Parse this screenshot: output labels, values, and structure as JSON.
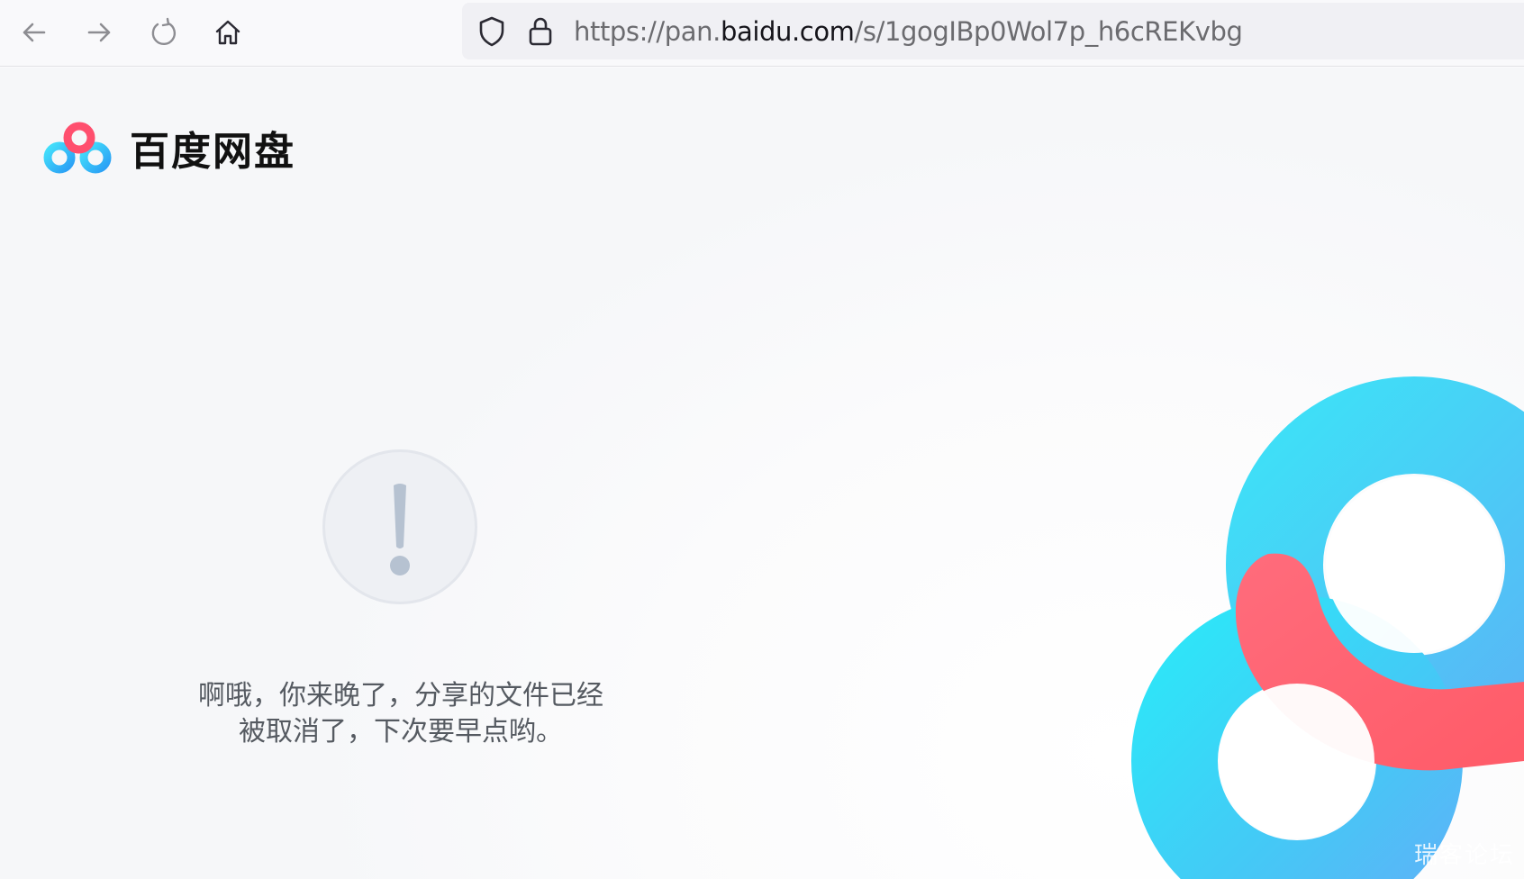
{
  "browser": {
    "url_prefix": "https://pan.",
    "url_domain": "baidu.com",
    "url_path": "/s/1gogIBp0Wol7p_h6cREKvbg"
  },
  "brand": {
    "name": "百度网盘"
  },
  "error": {
    "line1": "啊哦，你来晚了，分享的文件已经",
    "line2": "被取消了，下次要早点哟。"
  },
  "watermark": {
    "text": "瑞客论坛"
  },
  "colors": {
    "logo_blue": "#2fd3f7",
    "logo_red": "#ff4f6e",
    "deco_blue": "#33d9f6",
    "deco_red": "#ff6f7a",
    "text_gray": "#555a61"
  },
  "icons": {
    "back": "arrow-left-icon",
    "forward": "arrow-right-icon",
    "reload": "reload-icon",
    "home": "home-icon",
    "tracking": "shield-icon",
    "secure": "lock-icon",
    "error": "exclamation-icon"
  }
}
